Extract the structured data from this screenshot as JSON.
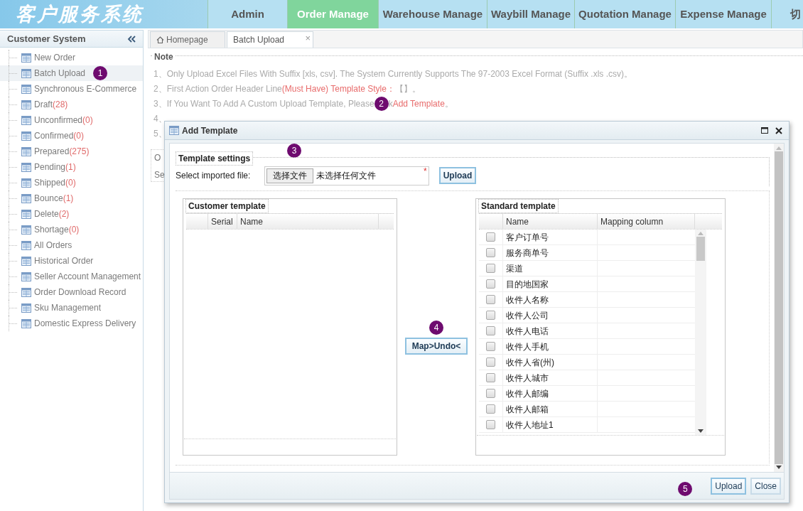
{
  "header": {
    "logo": "客户服务系统",
    "nav": [
      {
        "label": "Admin",
        "selected": false
      },
      {
        "label": "Order Manage",
        "selected": true
      },
      {
        "label": "Warehouse Manage",
        "selected": false
      },
      {
        "label": "Waybill Manage",
        "selected": false
      },
      {
        "label": "Quotation Manage",
        "selected": false
      },
      {
        "label": "Expense Manage",
        "selected": false
      },
      {
        "label": "切",
        "selected": false
      }
    ]
  },
  "sidebar": {
    "title": "Customer System",
    "items": [
      {
        "label": "New Order",
        "selected": false
      },
      {
        "label": "Batch Upload",
        "selected": true,
        "badge": "1"
      },
      {
        "label": "Synchronous E-Commerce",
        "selected": false
      },
      {
        "label": "Draft",
        "count": "(28)",
        "selected": false
      },
      {
        "label": "Unconfirmed",
        "count": "(0)",
        "selected": false
      },
      {
        "label": "Confirmed",
        "count": "(0)",
        "selected": false
      },
      {
        "label": "Prepared",
        "count": "(275)",
        "selected": false
      },
      {
        "label": "Pending",
        "count": "(1)",
        "selected": false
      },
      {
        "label": "Shipped",
        "count": "(0)",
        "selected": false
      },
      {
        "label": "Bounce",
        "count": "(1)",
        "selected": false
      },
      {
        "label": "Delete",
        "count": "(2)",
        "selected": false
      },
      {
        "label": "Shortage",
        "count": "(0)",
        "selected": false
      },
      {
        "label": "All Orders",
        "selected": false
      },
      {
        "label": "Historical Order",
        "selected": false
      },
      {
        "label": "Seller Account Management",
        "selected": false
      },
      {
        "label": "Order Download Record",
        "selected": false
      },
      {
        "label": "Sku Management",
        "selected": false
      },
      {
        "label": "Domestic Express Delivery",
        "selected": false
      }
    ]
  },
  "tabs": [
    {
      "label": "Homepage",
      "kind": "home",
      "selected": false
    },
    {
      "label": "Batch Upload",
      "kind": "closable",
      "close": "×",
      "selected": true
    }
  ],
  "note": {
    "legend": "Note",
    "lines": [
      [
        {
          "kind": "plain",
          "text": "1、Only Upload Excel Files With Suffix [xls, csv]. The System Currently Supports The 97-2003 Excel Format (Suffix .xls .csv)。"
        }
      ],
      [
        {
          "kind": "plain",
          "text": "2、First Action Order Header Line"
        },
        {
          "kind": "red",
          "text": "(Must Have) Template Style："
        },
        {
          "kind": "plain",
          "text": "【】。"
        }
      ],
      [
        {
          "kind": "plain",
          "text": "3、If You Want To Add A Custom Upload Template, Please"
        },
        {
          "kind": "badge",
          "text": "2"
        },
        {
          "kind": "plain",
          "text": "k"
        },
        {
          "kind": "link",
          "text": "Add Template"
        },
        {
          "kind": "plain",
          "text": "。"
        }
      ],
      [
        {
          "kind": "plain",
          "text": "4、"
        }
      ],
      [
        {
          "kind": "plain",
          "text": "5、"
        }
      ]
    ]
  },
  "section_2": {
    "legend": "O",
    "text": "Se"
  },
  "dialog": {
    "title": "Add Template",
    "badge": "3",
    "settings": {
      "legend": "Template settings",
      "file_label": "Select imported file:",
      "file_button": "选择文件",
      "file_status": "未选择任何文件",
      "required_mark": "*",
      "upload": "Upload"
    },
    "customer_template": {
      "legend": "Customer template",
      "columns": [
        "Serial",
        "Name"
      ]
    },
    "map_badge": "4",
    "map_button": "Map>Undo<",
    "standard_template": {
      "legend": "Standard template",
      "columns": [
        "Name",
        "Mapping column"
      ],
      "rows": [
        {
          "name": "客户订单号",
          "checked": false
        },
        {
          "name": "服务商单号",
          "checked": false
        },
        {
          "name": "渠道",
          "checked": false
        },
        {
          "name": "目的地国家",
          "checked": false
        },
        {
          "name": "收件人名称",
          "checked": false
        },
        {
          "name": "收件人公司",
          "checked": false
        },
        {
          "name": "收件人电话",
          "checked": false
        },
        {
          "name": "收件人手机",
          "checked": false
        },
        {
          "name": "收件人省(州)",
          "checked": false
        },
        {
          "name": "收件人城市",
          "checked": false
        },
        {
          "name": "收件人邮编",
          "checked": false
        },
        {
          "name": "收件人邮箱",
          "checked": false
        },
        {
          "name": "收件人地址1",
          "checked": false
        }
      ]
    },
    "footer_badge": "5",
    "buttons": [
      "Upload",
      "Close"
    ]
  }
}
